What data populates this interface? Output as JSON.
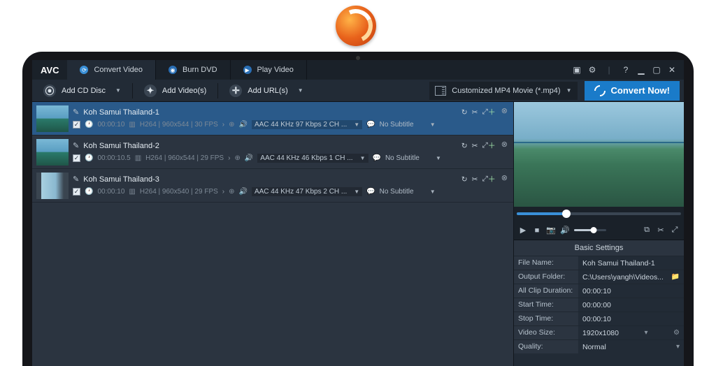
{
  "app": {
    "name": "AVC"
  },
  "tabs": {
    "convert": "Convert Video",
    "burn": "Burn DVD",
    "play": "Play Video"
  },
  "toolbar": {
    "add_cd": "Add CD Disc",
    "add_videos": "Add Video(s)",
    "add_urls": "Add URL(s)"
  },
  "profile": {
    "label": "Customized MP4 Movie (*.mp4)"
  },
  "convert_btn": "Convert Now!",
  "items": [
    {
      "title": "Koh Samui Thailand-1",
      "duration": "00:00:10",
      "codec": "H264 | 960x544 | 30 FPS",
      "audio": "AAC 44 KHz 97 Kbps 2 CH ...",
      "subtitle": "No Subtitle"
    },
    {
      "title": "Koh Samui Thailand-2",
      "duration": "00:00:10.5",
      "codec": "H264 | 960x544 | 29 FPS",
      "audio": "AAC 44 KHz 46 Kbps 1 CH ...",
      "subtitle": "No Subtitle"
    },
    {
      "title": "Koh Samui Thailand-3",
      "duration": "00:00:10",
      "codec": "H264 | 960x540 | 29 FPS",
      "audio": "AAC 44 KHz 47 Kbps 2 CH ...",
      "subtitle": "No Subtitle"
    }
  ],
  "settings": {
    "header": "Basic Settings",
    "file_name_label": "File Name:",
    "file_name": "Koh Samui Thailand-1",
    "output_folder_label": "Output Folder:",
    "output_folder": "C:\\Users\\yangh\\Videos...",
    "all_clip_label": "All Clip Duration:",
    "all_clip": "00:00:10",
    "start_time_label": "Start Time:",
    "start_time": "00:00:00",
    "stop_time_label": "Stop Time:",
    "stop_time": "00:00:10",
    "video_size_label": "Video Size:",
    "video_size": "1920x1080",
    "quality_label": "Quality:",
    "quality": "Normal"
  }
}
